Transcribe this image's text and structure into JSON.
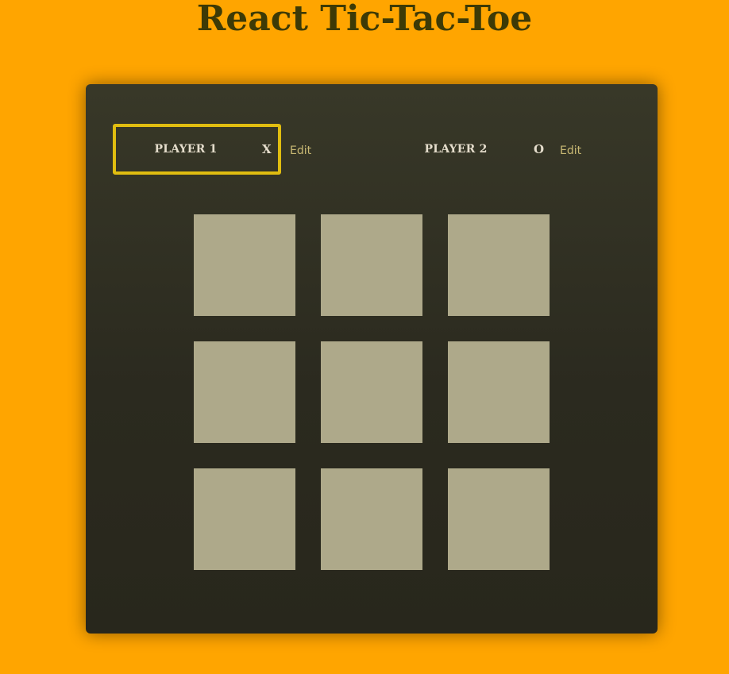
{
  "page": {
    "title": "React Tic-Tac-Toe"
  },
  "colors": {
    "background": "#ffa500",
    "panel": "#2f2e21",
    "active_border": "#e0bd10",
    "cell": "#aea98a",
    "title": "#3d3a06",
    "edit_link": "#c9b974"
  },
  "players": [
    {
      "name": "PLAYER 1",
      "symbol": "X",
      "edit_label": "Edit",
      "active": true
    },
    {
      "name": "PLAYER 2",
      "symbol": "O",
      "edit_label": "Edit",
      "active": false
    }
  ],
  "board": [
    [
      "",
      "",
      ""
    ],
    [
      "",
      "",
      ""
    ],
    [
      "",
      "",
      ""
    ]
  ]
}
